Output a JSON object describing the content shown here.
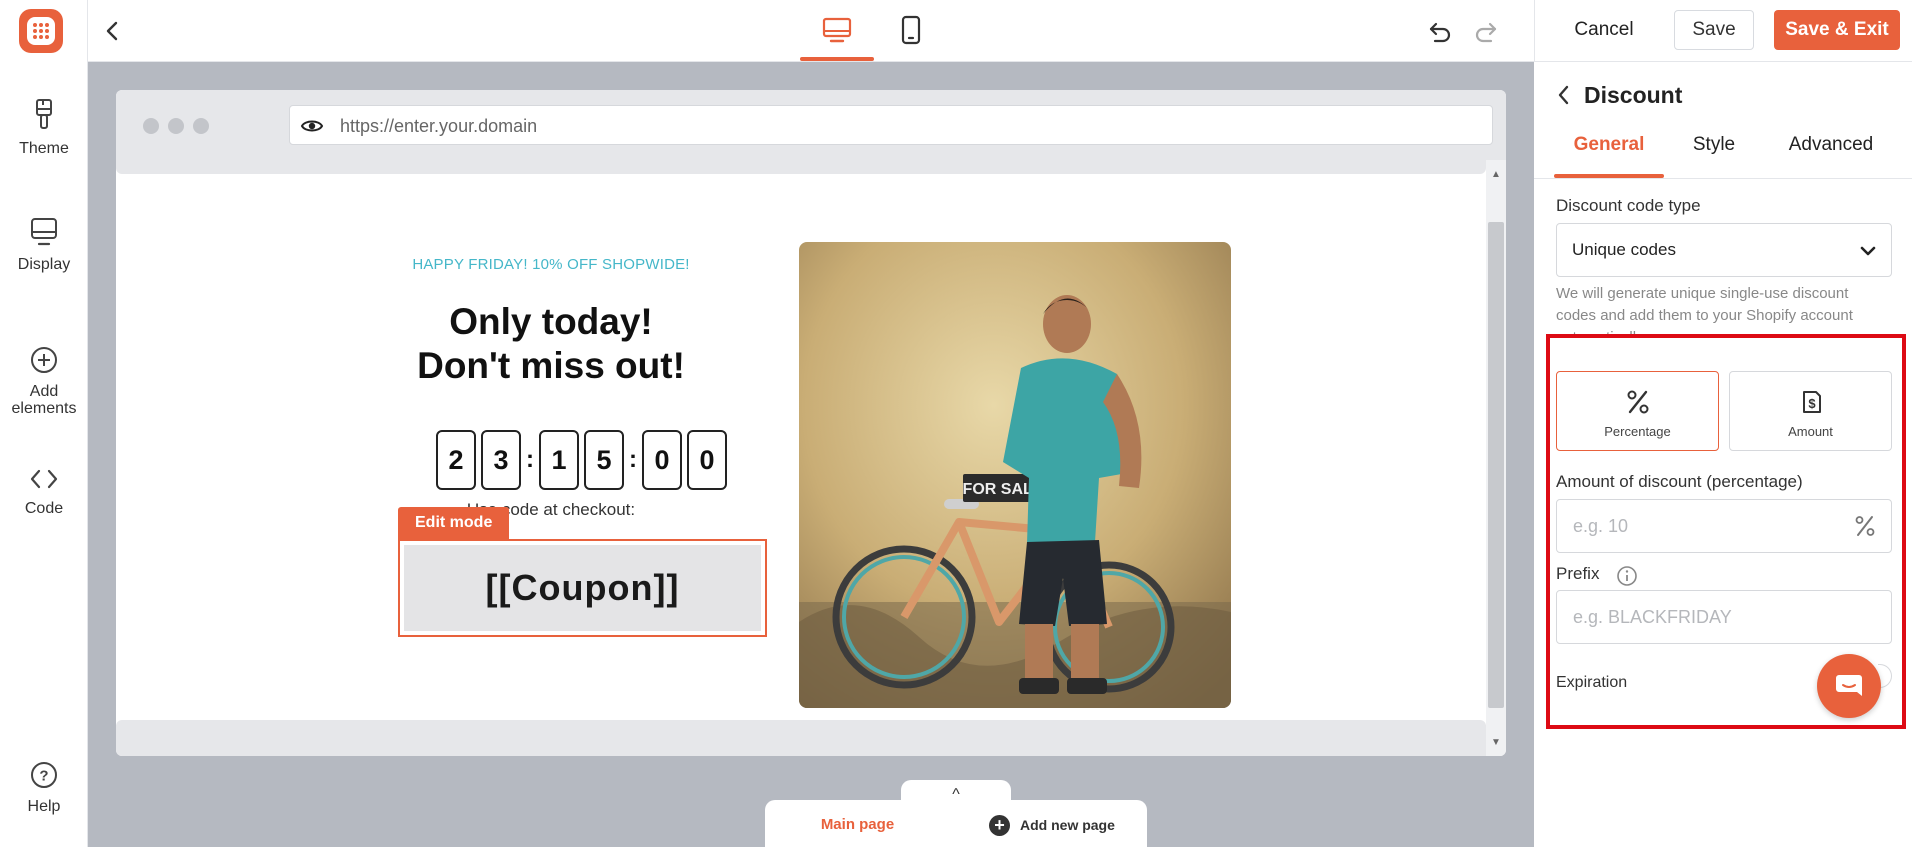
{
  "sidebar": {
    "items": [
      {
        "label": "Theme",
        "icon": "brush-icon"
      },
      {
        "label": "Display",
        "icon": "monitor-icon"
      },
      {
        "label_line1": "Add",
        "label_line2": "elements",
        "icon": "plus-circle-icon"
      },
      {
        "label": "Code",
        "icon": "code-icon"
      }
    ],
    "help": {
      "label": "Help",
      "icon": "help-circle-icon"
    }
  },
  "toolbar": {
    "device_active": "desktop",
    "cancel_label": "Cancel",
    "save_label": "Save",
    "save_exit_label": "Save & Exit"
  },
  "preview": {
    "url": "https://enter.your.domain",
    "kicker": "HAPPY FRIDAY! 10% OFF SHOPWIDE!",
    "headline_line1": "Only today!",
    "headline_line2": "Don't miss out!",
    "countdown": [
      "2",
      "3",
      "1",
      "5",
      "0",
      "0"
    ],
    "use_code": "Use code at checkout:",
    "edit_mode_label": "Edit mode",
    "coupon": "[[Coupon]]",
    "image_sign": "FOR SALE"
  },
  "pages": {
    "main_label": "Main page",
    "add_label": "Add new page"
  },
  "panel": {
    "title": "Discount",
    "tabs": [
      "General",
      "Style",
      "Advanced"
    ],
    "active_tab": "General",
    "code_type_label": "Discount code type",
    "code_type_value": "Unique codes",
    "helper_text": "We will generate unique single-use discount codes and add them to your Shopify account automatically.",
    "type_options": [
      {
        "label": "Percentage",
        "icon": "percent-icon",
        "selected": true
      },
      {
        "label": "Amount",
        "icon": "amount-icon",
        "selected": false
      }
    ],
    "amount_label": "Amount of discount (percentage)",
    "amount_placeholder": "e.g. 10",
    "prefix_label": "Prefix",
    "prefix_placeholder": "e.g. BLACKFRIDAY",
    "expiration_label": "Expiration"
  },
  "colors": {
    "accent": "#e8613c",
    "kicker": "#45b7c9",
    "highlight": "#dd0a14"
  }
}
